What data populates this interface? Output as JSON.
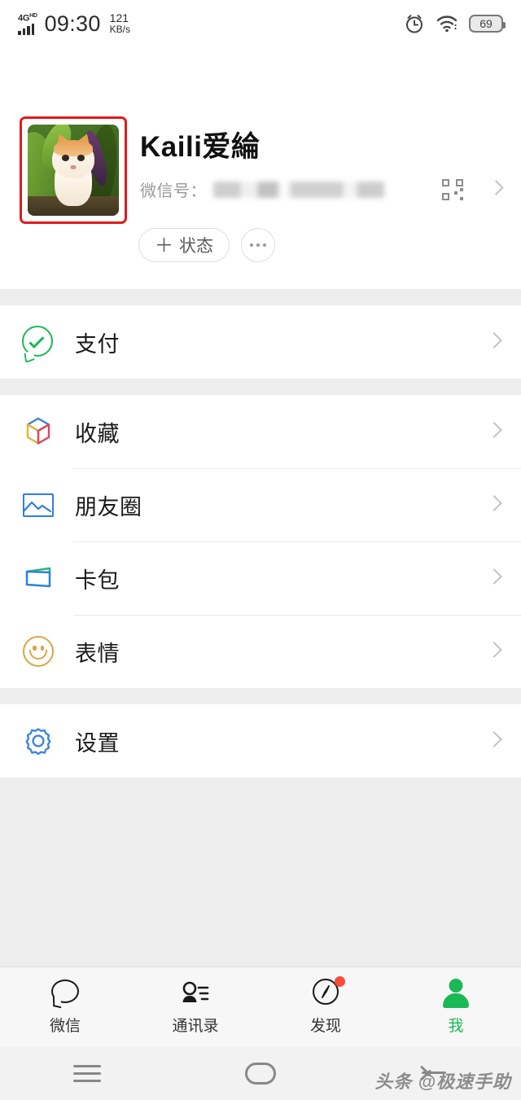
{
  "status_bar": {
    "network_type": "4G",
    "network_suffix": "HD",
    "time": "09:30",
    "data_rate_value": "121",
    "data_rate_unit": "KB/s",
    "alarm_icon": "alarm-clock-icon",
    "wifi_icon": "wifi-icon",
    "battery_percent": "69"
  },
  "profile": {
    "avatar_alt": "cat-avatar",
    "name": "Kaili爱綸",
    "wechat_id_label": "微信号：",
    "wechat_id_value": "",
    "qr_icon": "qr-code-icon",
    "chevron_icon": "chevron-right-icon",
    "status_button": {
      "plus": "＋",
      "label": "状态"
    },
    "more_button_label": "•••"
  },
  "menu_groups": [
    {
      "items": [
        {
          "label": "支付",
          "icon": "wechat-pay-icon",
          "color": "#19b955"
        }
      ]
    },
    {
      "items": [
        {
          "label": "收藏",
          "icon": "favorites-cube-icon",
          "color": "#2e7fe0"
        },
        {
          "label": "朋友圈",
          "icon": "moments-photo-icon",
          "color": "#2e7fe0"
        },
        {
          "label": "卡包",
          "icon": "cards-wallet-icon",
          "color": "#2e7fe0"
        },
        {
          "label": "表情",
          "icon": "sticker-smiley-icon",
          "color": "#dfa445"
        }
      ]
    },
    {
      "items": [
        {
          "label": "设置",
          "icon": "settings-gear-icon",
          "color": "#2e7fe0"
        }
      ]
    }
  ],
  "tab_bar": {
    "active_color": "#19b955",
    "tabs": [
      {
        "label": "微信",
        "icon": "chat-bubble-icon",
        "active": false,
        "badge": false
      },
      {
        "label": "通讯录",
        "icon": "contacts-icon",
        "active": false,
        "badge": false
      },
      {
        "label": "发现",
        "icon": "compass-icon",
        "active": false,
        "badge": true
      },
      {
        "label": "我",
        "icon": "person-icon",
        "active": true,
        "badge": false
      }
    ]
  },
  "nav_bar": {
    "recents_icon": "menu-lines-icon",
    "home_icon": "home-pill-icon",
    "back_icon": "back-arrow-icon"
  },
  "watermark": "头条 @极速手助"
}
